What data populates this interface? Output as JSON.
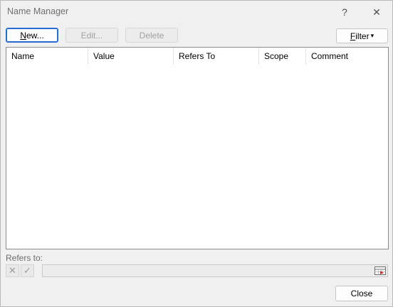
{
  "window": {
    "title": "Name Manager",
    "help_glyph": "?",
    "close_glyph": "✕"
  },
  "toolbar": {
    "new_prefix": "N",
    "new_rest": "ew...",
    "edit_label": "Edit...",
    "delete_label": "Delete",
    "filter_prefix": "F",
    "filter_rest": "ilter",
    "filter_arrow": "▾"
  },
  "table": {
    "columns": [
      "Name",
      "Value",
      "Refers To",
      "Scope",
      "Comment"
    ],
    "rows": []
  },
  "refers": {
    "label": "Refers to:",
    "cancel_glyph": "✕",
    "confirm_glyph": "✓",
    "value": ""
  },
  "footer": {
    "close_label": "Close"
  },
  "colors": {
    "accent": "#2a6bd1",
    "background": "#f0f0f0"
  }
}
